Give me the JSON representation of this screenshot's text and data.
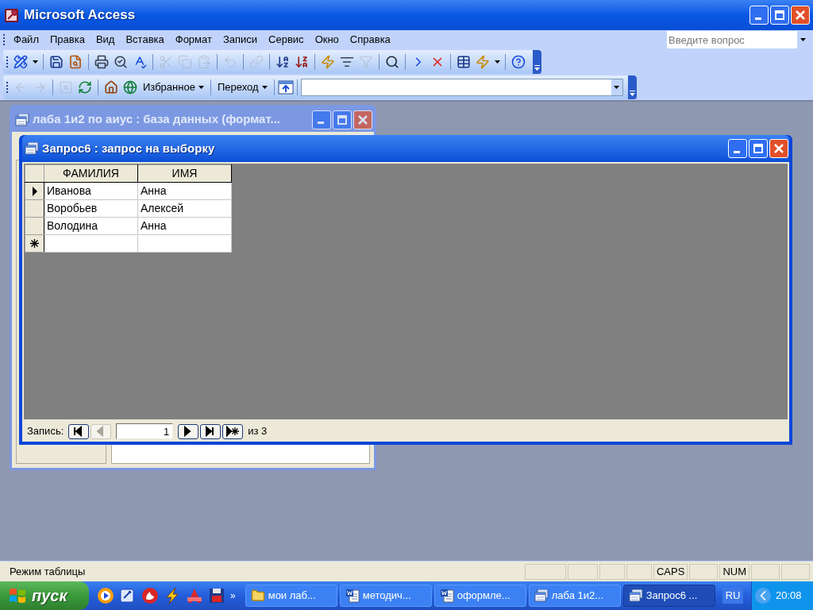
{
  "window": {
    "title": "Microsoft Access"
  },
  "menu": [
    {
      "label": "Файл"
    },
    {
      "label": "Правка"
    },
    {
      "label": "Вид"
    },
    {
      "label": "Вставка"
    },
    {
      "label": "Формат"
    },
    {
      "label": "Записи"
    },
    {
      "label": "Сервис"
    },
    {
      "label": "Окно"
    },
    {
      "label": "Справка"
    }
  ],
  "help_box": {
    "placeholder": "Введите вопрос"
  },
  "toolbar": [
    {
      "kind": "design",
      "disabled": false
    },
    {
      "kind": "dropdown",
      "disabled": false
    },
    {
      "kind": "separator"
    },
    {
      "kind": "save",
      "disabled": false
    },
    {
      "kind": "search-file",
      "disabled": false
    },
    {
      "kind": "separator"
    },
    {
      "kind": "print",
      "disabled": false
    },
    {
      "kind": "preview",
      "disabled": false
    },
    {
      "kind": "spelling",
      "disabled": false
    },
    {
      "kind": "separator"
    },
    {
      "kind": "cut",
      "disabled": true
    },
    {
      "kind": "copy",
      "disabled": true
    },
    {
      "kind": "paste",
      "disabled": true
    },
    {
      "kind": "separator"
    },
    {
      "kind": "undo",
      "disabled": true
    },
    {
      "kind": "separator"
    },
    {
      "kind": "link",
      "disabled": true
    },
    {
      "kind": "separator"
    },
    {
      "kind": "sort-asc",
      "disabled": false
    },
    {
      "kind": "sort-desc",
      "disabled": false
    },
    {
      "kind": "separator"
    },
    {
      "kind": "filter-selection",
      "disabled": false
    },
    {
      "kind": "filter-form",
      "disabled": false
    },
    {
      "kind": "filter-apply",
      "disabled": true
    },
    {
      "kind": "separator"
    },
    {
      "kind": "find",
      "disabled": false
    },
    {
      "kind": "separator"
    },
    {
      "kind": "new-record",
      "disabled": false
    },
    {
      "kind": "delete-record",
      "disabled": false
    },
    {
      "kind": "separator"
    },
    {
      "kind": "database",
      "disabled": false
    },
    {
      "kind": "new-object",
      "disabled": false
    },
    {
      "kind": "dropdown",
      "disabled": false
    },
    {
      "kind": "separator"
    },
    {
      "kind": "help",
      "disabled": false
    }
  ],
  "web_toolbar": {
    "items": [
      {
        "kind": "back",
        "disabled": true
      },
      {
        "kind": "forward",
        "disabled": true
      },
      {
        "kind": "separator"
      },
      {
        "kind": "stop",
        "disabled": true
      },
      {
        "kind": "refresh",
        "disabled": false
      },
      {
        "kind": "separator"
      },
      {
        "kind": "home",
        "disabled": false
      },
      {
        "kind": "search-web",
        "disabled": false
      }
    ],
    "favorites": "Избранное",
    "go": "Переход"
  },
  "db_window": {
    "title": "лаба 1и2 по аиус : база данных (формат..."
  },
  "query_window": {
    "title": "Запрос6 : запрос на выборку",
    "columns": [
      "ФАМИЛИЯ",
      "ИМЯ"
    ],
    "rows": [
      {
        "cells": [
          "Иванова",
          "Анна"
        ],
        "current": true
      },
      {
        "cells": [
          "Воробьев",
          "Алексей"
        ],
        "current": false
      },
      {
        "cells": [
          "Володина",
          "Анна"
        ],
        "current": false
      }
    ],
    "navigator": {
      "label": "Запись:",
      "buttons_before": [
        {
          "kind": "first",
          "disabled": false
        },
        {
          "kind": "prev",
          "disabled": true
        }
      ],
      "current": "1",
      "buttons_after": [
        {
          "kind": "next",
          "disabled": false
        },
        {
          "kind": "last",
          "disabled": false
        },
        {
          "kind": "new",
          "disabled": false
        }
      ],
      "count": "из 3"
    }
  },
  "status_bar": {
    "text": "Режим таблицы",
    "indicators": [
      {
        "label": "CAPS"
      },
      {
        "label": "NUM"
      }
    ]
  },
  "taskbar": {
    "start": "пуск",
    "overflow": "»",
    "buttons": [
      {
        "label": "мои лаб...",
        "kind": "folder",
        "selected": false
      },
      {
        "label": "методич...",
        "kind": "word",
        "selected": false
      },
      {
        "label": "оформле...",
        "kind": "word",
        "selected": false
      },
      {
        "label": "лаба 1и2...",
        "kind": "access",
        "selected": false
      },
      {
        "label": "Запрос6 ...",
        "kind": "access",
        "selected": true
      }
    ],
    "language": "RU",
    "clock": "20:08"
  }
}
